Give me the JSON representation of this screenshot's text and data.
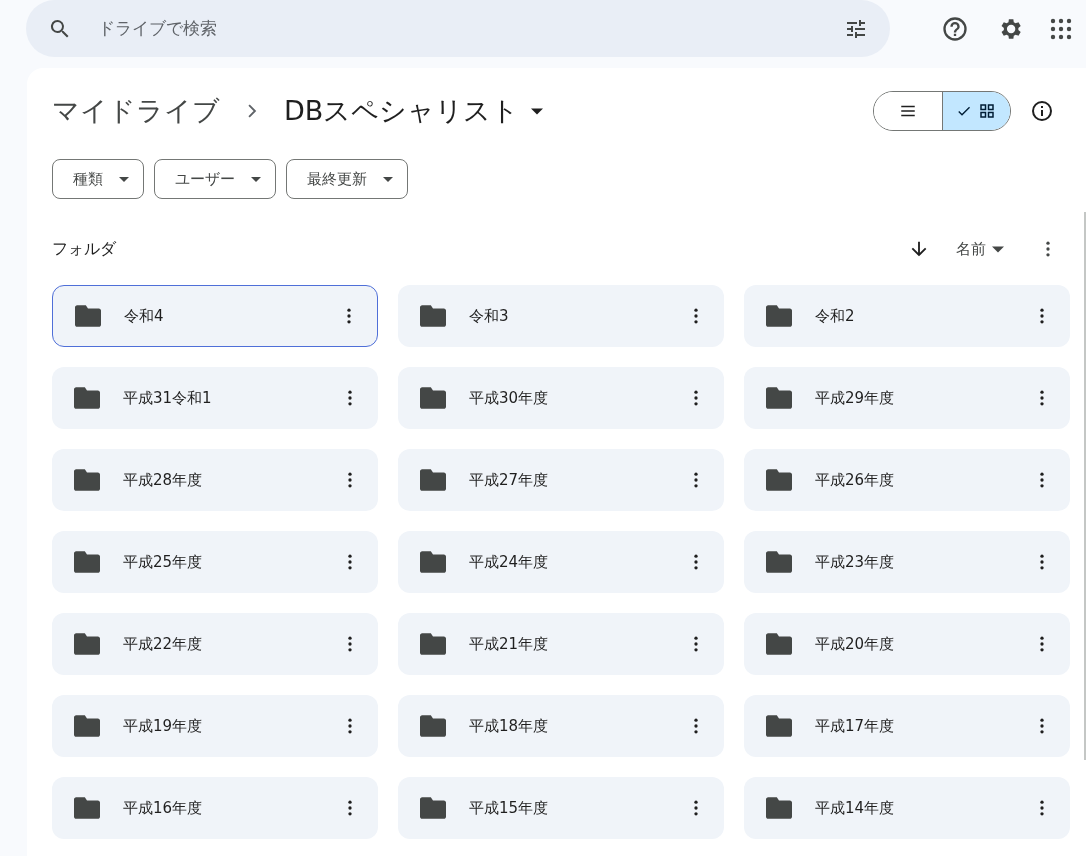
{
  "search": {
    "placeholder": "ドライブで検索"
  },
  "breadcrumb": [
    {
      "label": "マイドライブ",
      "current": false
    },
    {
      "label": "DBスペシャリスト",
      "current": true
    }
  ],
  "view_toggle": [
    {
      "kind": "list",
      "selected": false
    },
    {
      "kind": "grid",
      "selected": true
    }
  ],
  "filters": [
    "種類",
    "ユーザー",
    "最終更新"
  ],
  "section_title": "フォルダ",
  "sort": {
    "label": "名前"
  },
  "folders": [
    {
      "name": "令和4",
      "selected": true
    },
    {
      "name": "令和3",
      "selected": false
    },
    {
      "name": "令和2",
      "selected": false
    },
    {
      "name": "平成31令和1",
      "selected": false
    },
    {
      "name": "平成30年度",
      "selected": false
    },
    {
      "name": "平成29年度",
      "selected": false
    },
    {
      "name": "平成28年度",
      "selected": false
    },
    {
      "name": "平成27年度",
      "selected": false
    },
    {
      "name": "平成26年度",
      "selected": false
    },
    {
      "name": "平成25年度",
      "selected": false
    },
    {
      "name": "平成24年度",
      "selected": false
    },
    {
      "name": "平成23年度",
      "selected": false
    },
    {
      "name": "平成22年度",
      "selected": false
    },
    {
      "name": "平成21年度",
      "selected": false
    },
    {
      "name": "平成20年度",
      "selected": false
    },
    {
      "name": "平成19年度",
      "selected": false
    },
    {
      "name": "平成18年度",
      "selected": false
    },
    {
      "name": "平成17年度",
      "selected": false
    },
    {
      "name": "平成16年度",
      "selected": false
    },
    {
      "name": "平成15年度",
      "selected": false
    },
    {
      "name": "平成14年度",
      "selected": false
    }
  ]
}
